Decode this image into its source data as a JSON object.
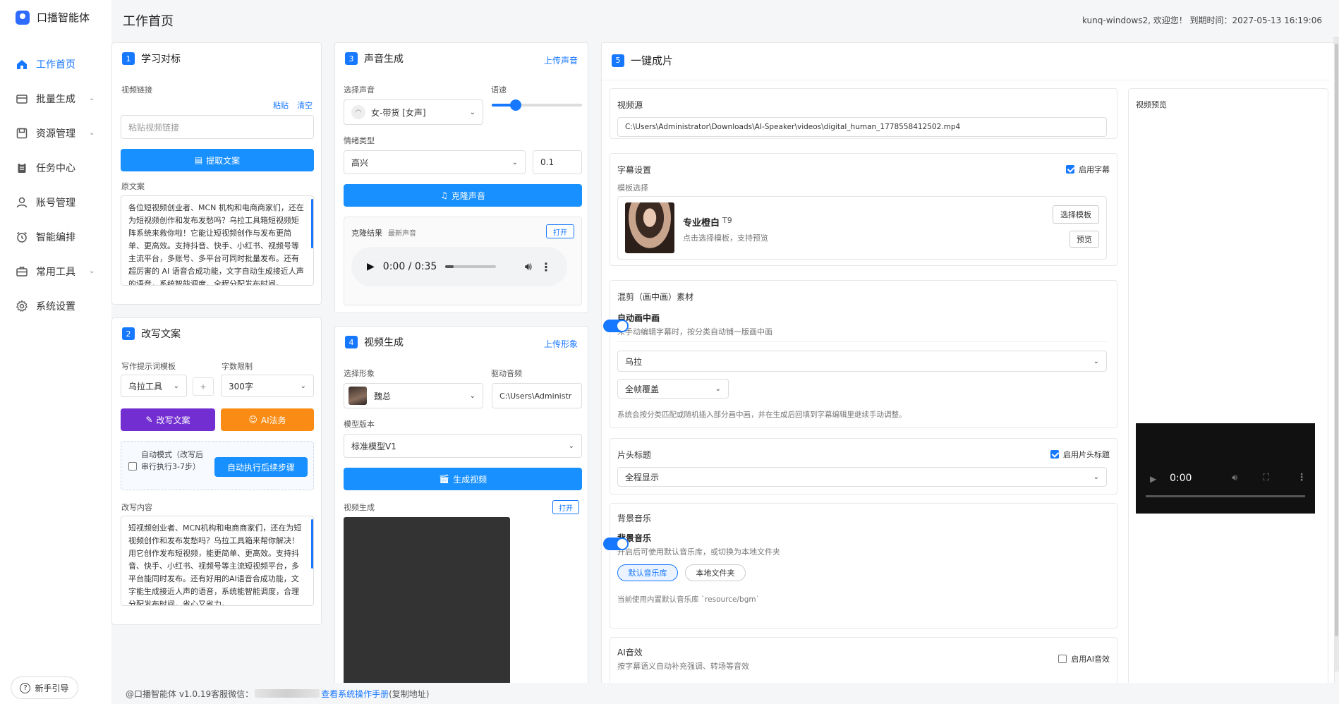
{
  "app": {
    "name": "口播智能体"
  },
  "header": {
    "title": "工作首页",
    "user_info": "kunq-windows2, 欢迎您！ 到期时间：2027-05-13 16:19:06"
  },
  "nav": [
    {
      "label": "工作首页",
      "icon": "home-icon",
      "active": true
    },
    {
      "label": "批量生成",
      "icon": "layers-icon",
      "expandable": true
    },
    {
      "label": "资源管理",
      "icon": "save-icon",
      "expandable": true
    },
    {
      "label": "任务中心",
      "icon": "clipboard-icon"
    },
    {
      "label": "账号管理",
      "icon": "user-icon"
    },
    {
      "label": "智能编排",
      "icon": "alarm-icon"
    },
    {
      "label": "常用工具",
      "icon": "briefcase-icon",
      "expandable": true
    },
    {
      "label": "系统设置",
      "icon": "gear-icon"
    }
  ],
  "guide_label": "新手引导",
  "card1": {
    "num": "1",
    "title": "学习对标",
    "link_label": "视频链接",
    "paste": "粘贴",
    "clear": "清空",
    "link_placeholder": "粘贴视频链接",
    "extract_btn": "提取文案",
    "orig_label": "原文案",
    "orig_text": "各位短视频创业者、MCN 机构和电商商家们，还在为短视频创作和发布发愁吗？乌拉工具箱短视频矩阵系统来救你啦！它能让短视频创作与发布更简单、更高效。支持抖音、快手、小红书、视频号等主流平台，多账号、多平台可同时批量发布。还有超厉害的 AI 语音合成功能，文字自动生成接近人声的语音，系统智能调度，全程分配发布时间。"
  },
  "card2": {
    "num": "2",
    "title": "改写文案",
    "prompt_label": "写作提示词模板",
    "prompt_value": "乌拉工具",
    "plus": "+",
    "limit_label": "字数限制",
    "limit_value": "300字",
    "rewrite_btn": "改写文案",
    "ai_btn": "AI法务",
    "auto_mode_text": "自动模式（改写后串行执行3-7步）",
    "auto_btn": "自动执行后续步骤",
    "rewrite_label": "改写内容",
    "rewrite_text": "短视频创业者、MCN机构和电商商家们，还在为短视频创作和发布发愁吗？乌拉工具箱来帮你解决！用它创作发布短视频，能更简单、更高效。支持抖音、快手、小红书、视频号等主流短视频平台，多平台能同时发布。还有好用的AI语音合成功能，文字能生成接近人声的语音，系统能智能调度，合理分配发布时间，省心又省力。"
  },
  "card3": {
    "num": "3",
    "title": "声音生成",
    "upload_link": "上传声音",
    "voice_label": "选择声音",
    "voice_value": "女-带货 [女声]",
    "speed_label": "语速",
    "speed_value": 0.25,
    "emotion_label": "情绪类型",
    "emotion_value": "高兴",
    "emotion_strength": "0.1",
    "clone_btn": "克隆声音",
    "result_label": "克隆结果",
    "latest": "最新声音",
    "open": "打开",
    "audio_time": "0:00 / 0:35"
  },
  "card4": {
    "num": "4",
    "title": "视频生成",
    "upload_link": "上传形象",
    "avatar_label": "选择形象",
    "avatar_value": "魏总",
    "audio_label": "驱动音频",
    "audio_value": "C:\\Users\\Administr",
    "model_label": "模型版本",
    "model_value": "标准模型V1",
    "gen_btn": "生成视频",
    "video_label": "视频生成",
    "open": "打开"
  },
  "card5": {
    "num": "5",
    "title": "一键成片",
    "source_title": "视频源",
    "source_value": "C:\\Users\\Administrator\\Downloads\\AI-Speaker\\videos\\digital_human_1778558412502.mp4",
    "subtitle_title": "字幕设置",
    "subtitle_check": "启用字幕",
    "template_label": "模板选择",
    "template_name": "专业橙白",
    "template_tag": "T9",
    "template_desc": "点击选择模板，支持预览",
    "select_template": "选择模板",
    "preview": "预览",
    "mix_title": "混剪（画中画）素材",
    "auto_pip": "自动画中画",
    "auto_pip_desc": "未手动编辑字幕时，按分类自动铺一版画中画",
    "mix_category": "乌拉",
    "mix_mode": "全帧覆盖",
    "mix_note": "系统会按分类匹配或随机插入部分画中画，并在生成后回填到字幕编辑里继续手动调整。",
    "head_title": "片头标题",
    "head_check": "启用片头标题",
    "head_value": "全程显示",
    "bgm_title": "背景音乐",
    "bgm_sub": "背景音乐",
    "bgm_desc": "开启后可使用默认音乐库，或切换为本地文件夹",
    "bgm_default": "默认音乐库",
    "bgm_local": "本地文件夹",
    "bgm_current": "当前使用内置默认音乐库 `resource/bgm`",
    "ai_title": "AI音效",
    "ai_desc": "按字幕语义自动补充强调、转场等音效",
    "ai_check": "启用AI音效",
    "preview_label": "视频预览",
    "preview_time": "0:00"
  },
  "footer": {
    "prefix": "@口播智能体 v1.0.19客服微信：",
    "link": "查看系统操作手册",
    "suffix": "(复制地址)"
  }
}
